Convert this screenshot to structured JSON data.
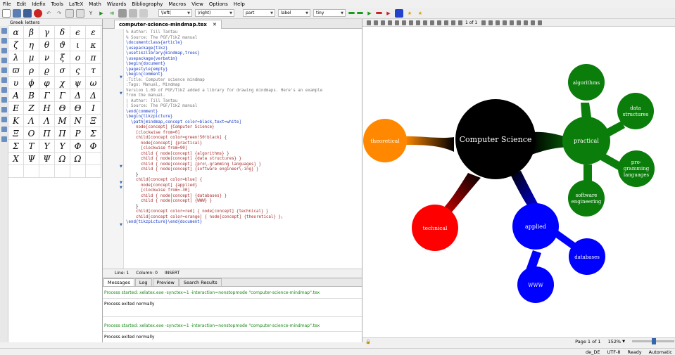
{
  "menu": [
    "File",
    "Edit",
    "Idefix",
    "Tools",
    "LaTeX",
    "Math",
    "Wizards",
    "Bibliography",
    "Macros",
    "View",
    "Options",
    "Help"
  ],
  "toolbar": {
    "combo_left": "\\left(",
    "combo_right": "\\right)",
    "combo_part": "part",
    "combo_label": "label",
    "combo_size": "tiny"
  },
  "greek_panel": {
    "title": "Greek letters",
    "letters": [
      "α",
      "β",
      "γ",
      "δ",
      "ϵ",
      "ε",
      "ζ",
      "η",
      "θ",
      "ϑ",
      "ι",
      "κ",
      "λ",
      "μ",
      "ν",
      "ξ",
      "o",
      "π",
      "ϖ",
      "ρ",
      "ϱ",
      "σ",
      "ς",
      "τ",
      "υ",
      "ϕ",
      "φ",
      "χ",
      "ψ",
      "ω",
      "A",
      "B",
      "Γ",
      "Γ",
      "Δ",
      "Δ",
      "E",
      "Z",
      "H",
      "Θ",
      "Θ",
      "I",
      "K",
      "Λ",
      "Λ",
      "M",
      "N",
      "Ξ",
      "Ξ",
      "O",
      "Π",
      "Π",
      "P",
      "Σ",
      "Σ",
      "T",
      "Υ",
      "Υ",
      "Φ",
      "Φ",
      "X",
      "Ψ",
      "Ψ",
      "Ω",
      "Ω"
    ]
  },
  "editor": {
    "tab_title": "computer-science-mindmap.tex",
    "close_glyph": "✕",
    "status_line": "Line: 1",
    "status_col": "Column: 0",
    "status_mode": "INSERT",
    "lines": [
      "% Author: Till Tantau",
      "% Source: The PGF/TikZ manual",
      "\\documentclass{article}",
      "",
      "\\usepackage{tikz}",
      "\\usetikzlibrary{mindmap,trees}",
      "\\usepackage{verbatim}",
      "",
      "\\begin{document}",
      "\\pagestyle{empty}",
      "",
      "\\begin{comment}",
      ":Title: Computer science mindmap",
      ":Tags: Manual, Mindmap",
      "",
      "Version 1.09 of PGF/TikZ added a library for drawing mindmaps. Here's an example",
      "from the manual.",
      "",
      "| Author: Till Tantau",
      "| Source: The PGF/TikZ manual",
      "",
      "\\end{comment}",
      "",
      "\\begin{tikzpicture}",
      "  \\path[mindmap,concept color=black,text=white]",
      "    node[concept] {Computer Science}",
      "    [clockwise from=0]",
      "    child[concept color=green!50!black] {",
      "      node[concept] {practical}",
      "      [clockwise from=90]",
      "      child { node[concept] {algorithms} }",
      "      child { node[concept] {data structures} }",
      "      child { node[concept] {pro\\-gramming languages} }",
      "      child { node[concept] {software engineer\\-ing} }",
      "    }",
      "    child[concept color=blue] {",
      "      node[concept] {applied}",
      "      [clockwise from=-30]",
      "      child { node[concept] {databases} }",
      "      child { node[concept] {WWW} }",
      "    }",
      "    child[concept color=red] { node[concept] {technical} }",
      "    child[concept color=orange] { node[concept] {theoretical} };",
      "\\end{tikzpicture}\\end{document}"
    ]
  },
  "messages": {
    "tabs": [
      "Messages",
      "Log",
      "Preview",
      "Search Results"
    ],
    "line1": "Process started: xelatex.exe -synctex=1 -interaction=nonstopmode \"computer-science-mindmap\".tex",
    "line2": "Process exited normally",
    "line3": "Process started: xelatex.exe -synctex=1 -interaction=nonstopmode \"computer-science-mindmap\".tex",
    "line4": "Process exited normally"
  },
  "viewer": {
    "page_indicator": "1 of 1",
    "status_page": "Page 1 of 1",
    "zoom": "152%",
    "mindmap": {
      "root": "Computer Science",
      "practical": "practical",
      "algorithms": "algorithms",
      "data_structures_1": "data",
      "data_structures_2": "structures",
      "programming_1": "pro-",
      "programming_2": "gramming",
      "programming_3": "languages",
      "software_1": "software",
      "software_2": "engineering",
      "applied": "applied",
      "databases": "databases",
      "www": "WWW",
      "technical": "technical",
      "theoretical": "theoretical",
      "colors": {
        "root": "#000000",
        "practical": "#0a7d0a",
        "applied": "#0000ff",
        "technical": "#ff0000",
        "theoretical": "#ff8800"
      }
    }
  },
  "statusbar": {
    "lang": "de_DE",
    "encoding": "UTF-8",
    "ready": "Ready",
    "mode": "Automatic"
  }
}
